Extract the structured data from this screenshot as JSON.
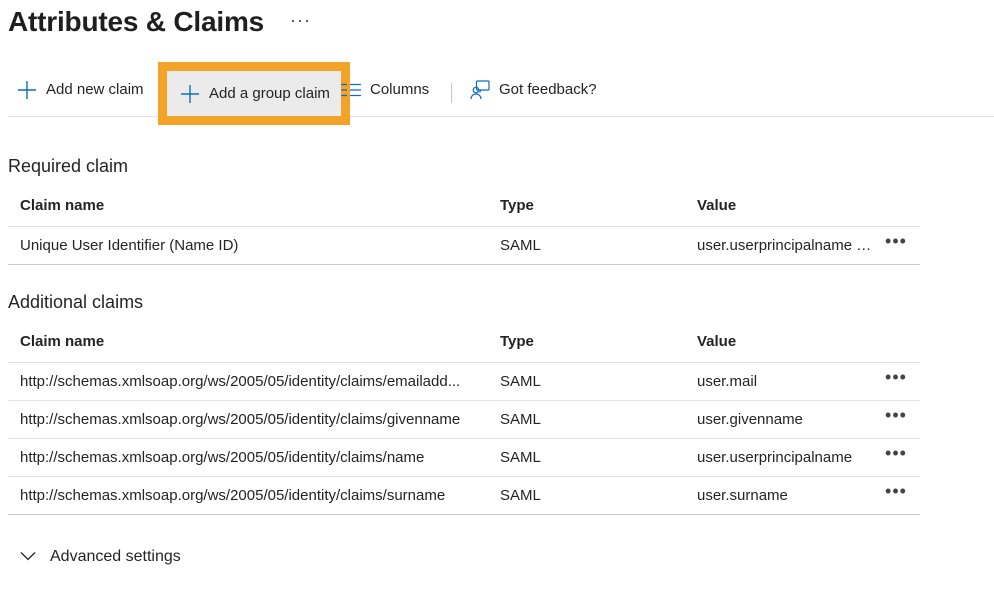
{
  "page": {
    "title": "Attributes & Claims",
    "more": "···"
  },
  "toolbar": {
    "add_claim_label": "Add new claim",
    "add_group_claim_label": "Add a group claim",
    "columns_label": "Columns",
    "feedback_label": "Got feedback?",
    "accent": "#0f6cbd",
    "highlight": "#f3a32a"
  },
  "required": {
    "title": "Required claim",
    "headers": {
      "name": "Claim name",
      "type": "Type",
      "value": "Value"
    },
    "rows": [
      {
        "name": "Unique User Identifier (Name ID)",
        "type": "SAML",
        "value": "user.userprincipalname [..."
      }
    ]
  },
  "additional": {
    "title": "Additional claims",
    "headers": {
      "name": "Claim name",
      "type": "Type",
      "value": "Value"
    },
    "rows": [
      {
        "name": "http://schemas.xmlsoap.org/ws/2005/05/identity/claims/emailadd...",
        "type": "SAML",
        "value": "user.mail"
      },
      {
        "name": "http://schemas.xmlsoap.org/ws/2005/05/identity/claims/givenname",
        "type": "SAML",
        "value": "user.givenname"
      },
      {
        "name": "http://schemas.xmlsoap.org/ws/2005/05/identity/claims/name",
        "type": "SAML",
        "value": "user.userprincipalname"
      },
      {
        "name": "http://schemas.xmlsoap.org/ws/2005/05/identity/claims/surname",
        "type": "SAML",
        "value": "user.surname"
      }
    ]
  },
  "row_more": "•••",
  "advanced": {
    "label": "Advanced settings"
  }
}
